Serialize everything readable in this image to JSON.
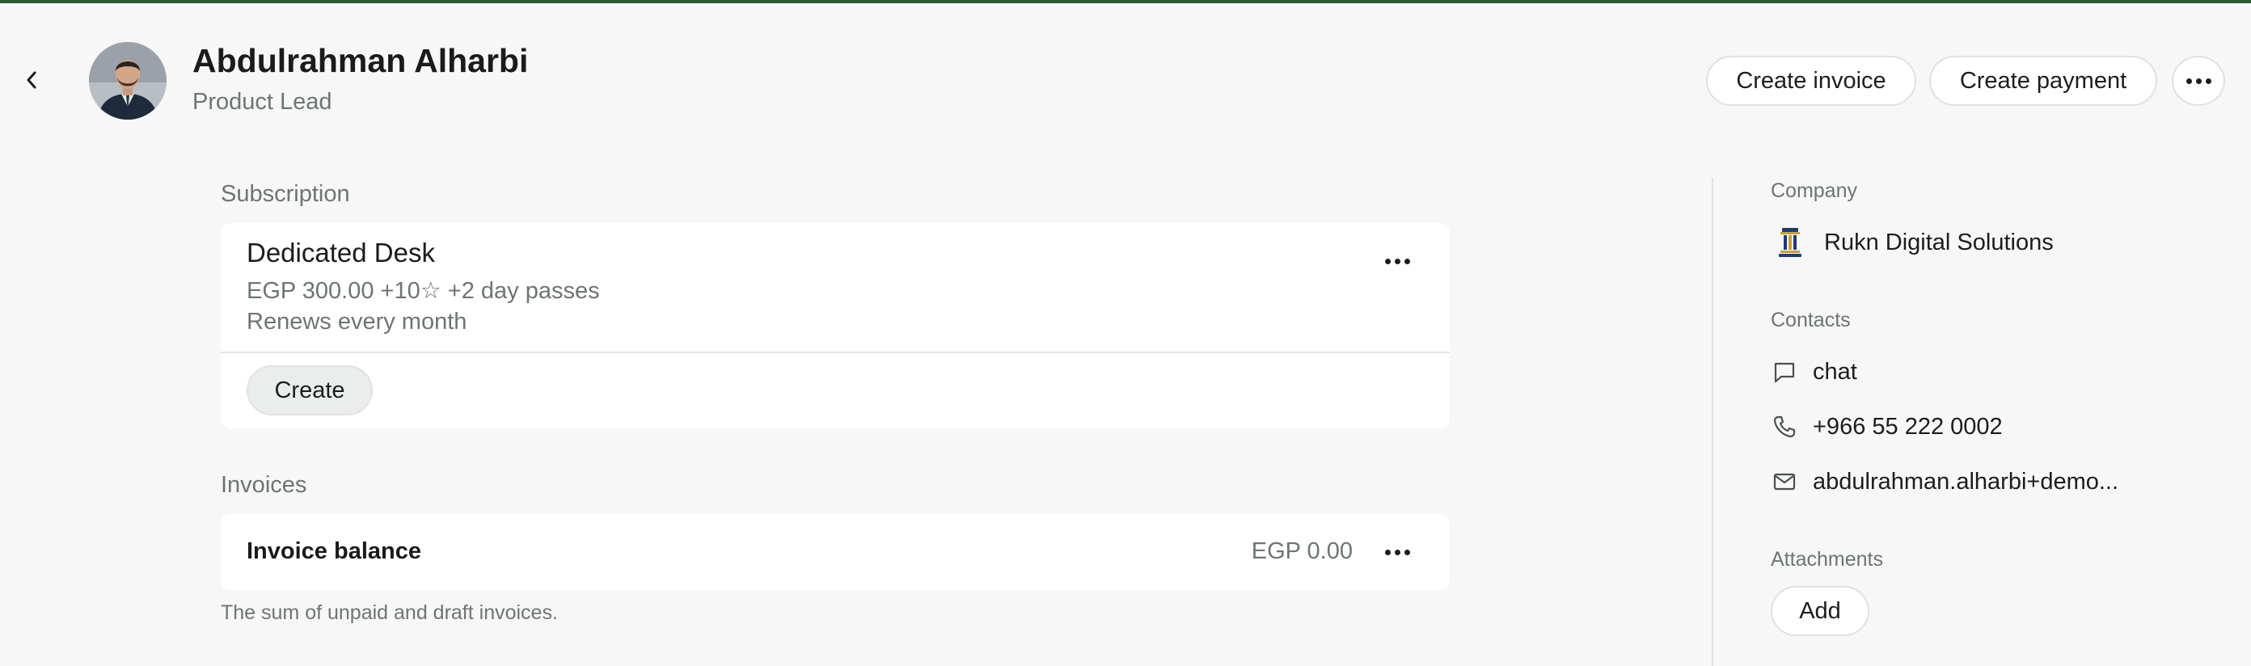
{
  "header": {
    "name": "Abdulrahman Alharbi",
    "role": "Product Lead",
    "actions": {
      "create_invoice": "Create invoice",
      "create_payment": "Create payment"
    }
  },
  "subscription": {
    "section_title": "Subscription",
    "plan_name": "Dedicated Desk",
    "price_line": "EGP 300.00 +10☆ +2 day passes",
    "renewal": "Renews every month",
    "create_label": "Create"
  },
  "invoices": {
    "section_title": "Invoices",
    "balance_label": "Invoice balance",
    "balance_amount": "EGP 0.00",
    "note": "The sum of unpaid and draft invoices."
  },
  "sidebar": {
    "company_title": "Company",
    "company_name": "Rukn Digital Solutions",
    "contacts_title": "Contacts",
    "contacts": [
      {
        "icon": "chat-icon",
        "text": "chat"
      },
      {
        "icon": "phone-icon",
        "text": "+966 55 222 0002"
      },
      {
        "icon": "mail-icon",
        "text": "abdulrahman.alharbi+demo..."
      }
    ],
    "attachments_title": "Attachments",
    "add_label": "Add"
  },
  "colors": {
    "background": "#f6f7f6",
    "card": "#ffffff",
    "accent_line": "#2e5a36",
    "muted_text": "#6d7570",
    "primary_text": "#1c1e1d"
  }
}
